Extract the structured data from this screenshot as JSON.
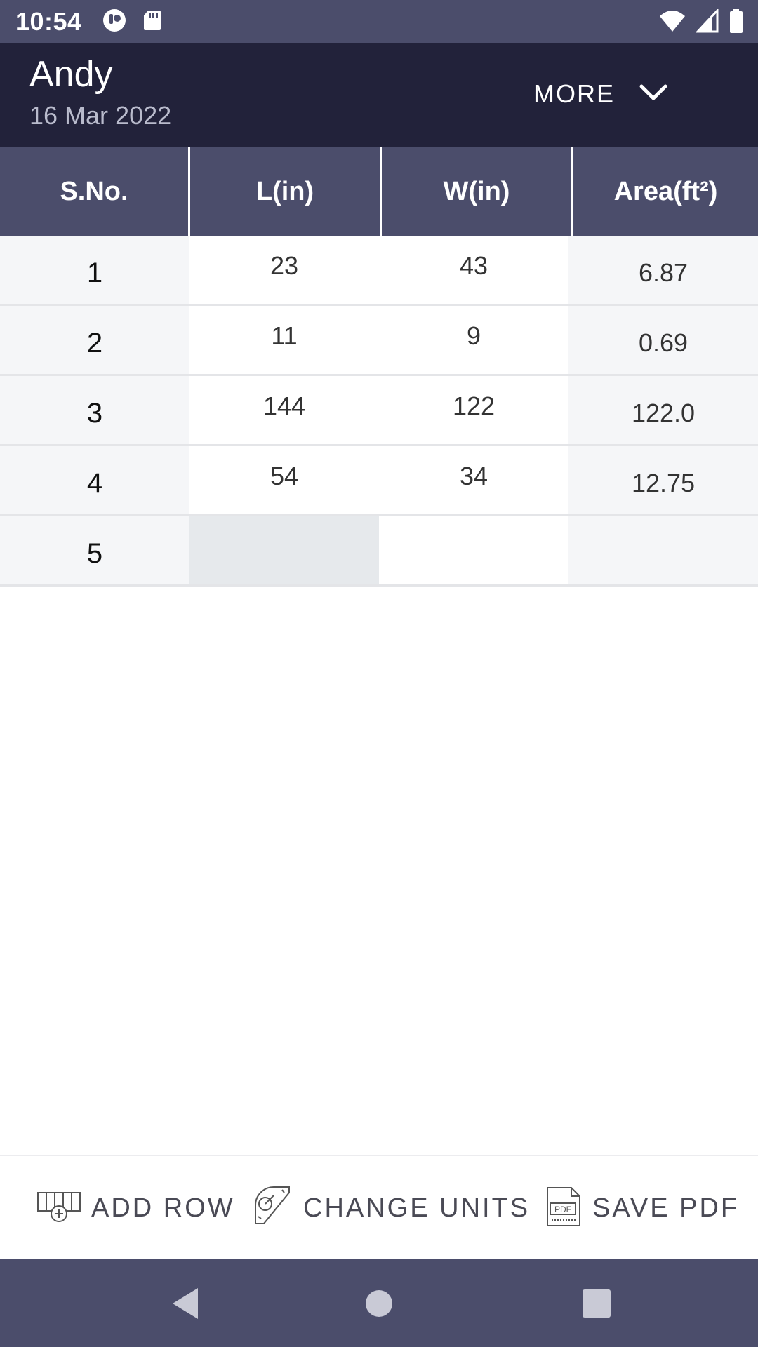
{
  "status_bar": {
    "time": "10:54",
    "icons": [
      "notification-app-icon",
      "sd-card-icon",
      "wifi-icon",
      "signal-icon",
      "battery-icon"
    ]
  },
  "header": {
    "name": "Andy",
    "date": "16 Mar 2022",
    "more_label": "MORE",
    "more_icon": "chevron-down-icon"
  },
  "table": {
    "columns": [
      "S.No.",
      "L(in)",
      "W(in)",
      "Area(ft²)"
    ],
    "rows": [
      {
        "sno": "1",
        "length": "23",
        "width": "43",
        "area": "6.87"
      },
      {
        "sno": "2",
        "length": "11",
        "width": "9",
        "area": "0.69"
      },
      {
        "sno": "3",
        "length": "144",
        "width": "122",
        "area": "122.0"
      },
      {
        "sno": "4",
        "length": "54",
        "width": "34",
        "area": "12.75"
      },
      {
        "sno": "5",
        "length": "",
        "width": "",
        "area": ""
      }
    ]
  },
  "toolbar": {
    "add_row_label": "ADD ROW",
    "change_units_label": "CHANGE UNITS",
    "save_pdf_label": "SAVE PDF",
    "pdf_icon_text": "PDF"
  },
  "nav": {
    "icons": [
      "back-icon",
      "home-icon",
      "recents-icon"
    ]
  },
  "colors": {
    "status_bar": "#4b4d6b",
    "header": "#22223a",
    "table_header": "#4b4d6b",
    "active_cell": "#e6e9ec"
  }
}
